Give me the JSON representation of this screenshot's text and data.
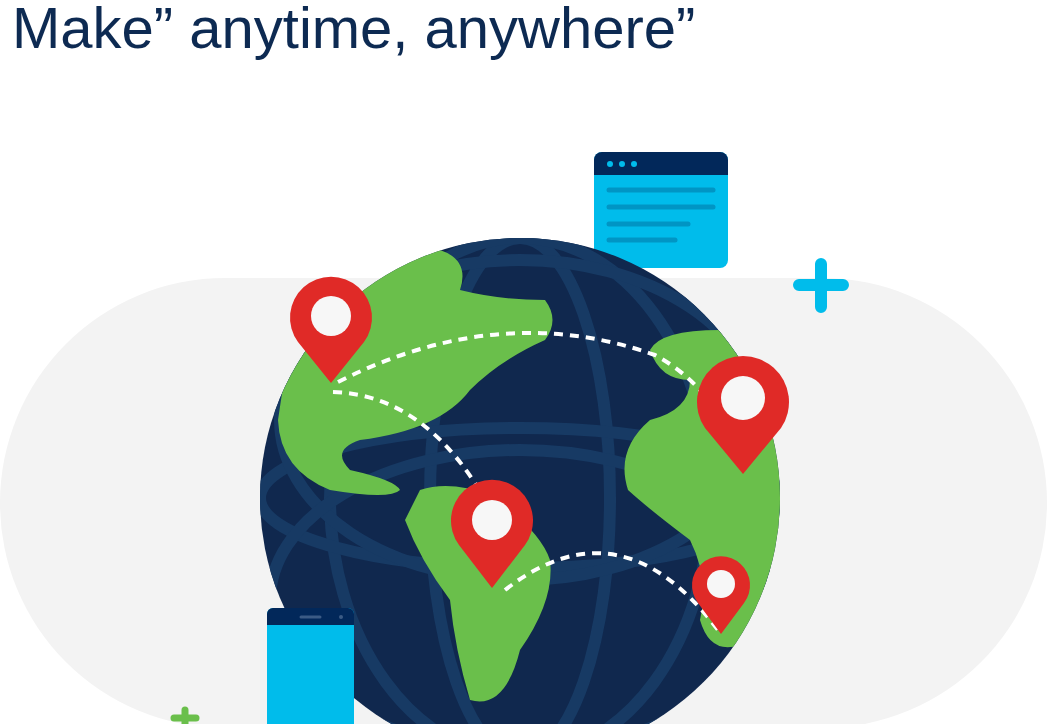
{
  "heading": "Make” anytime, anywhere”"
}
